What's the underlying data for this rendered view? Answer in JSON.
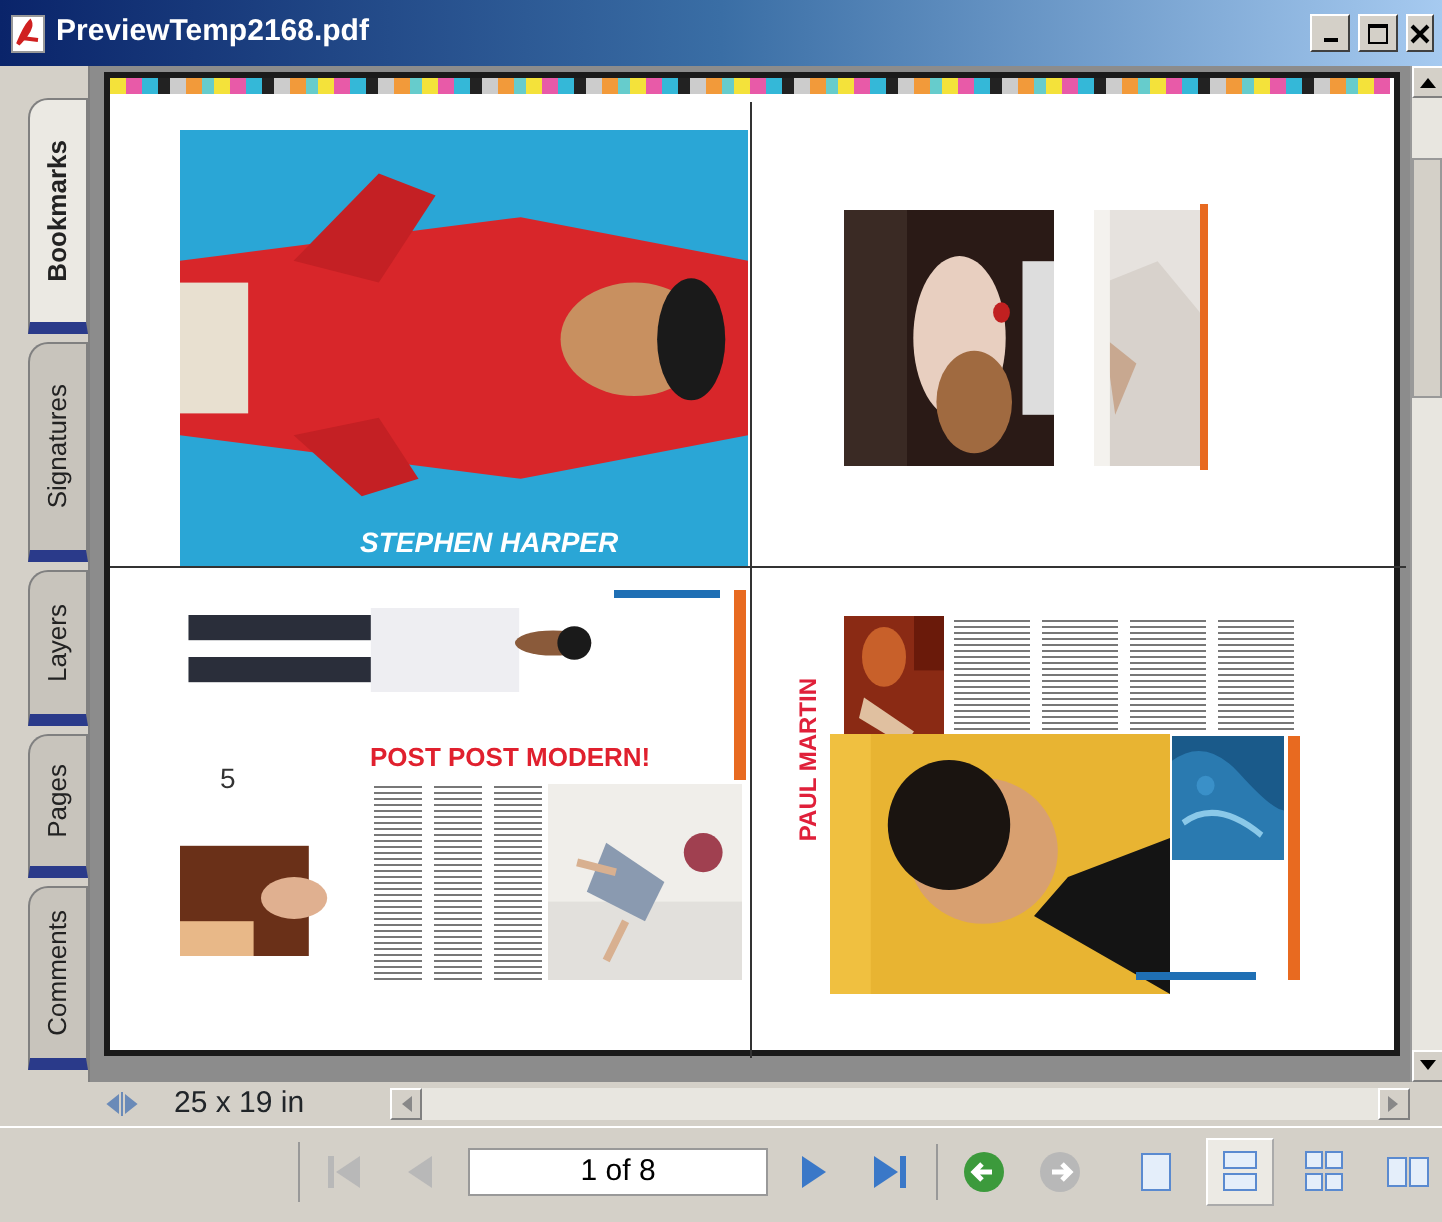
{
  "window": {
    "title": "PreviewTemp2168.pdf"
  },
  "side_tabs": [
    {
      "label": "Bookmarks",
      "selected": true
    },
    {
      "label": "Signatures",
      "selected": false
    },
    {
      "label": "Layers",
      "selected": false
    },
    {
      "label": "Pages",
      "selected": false
    },
    {
      "label": "Comments",
      "selected": false
    }
  ],
  "document": {
    "texts": [
      {
        "kind": "caption",
        "text": "STEPHEN HARPER"
      },
      {
        "kind": "headline",
        "text": "POST POST MODERN!"
      },
      {
        "kind": "page-number",
        "text": "5"
      },
      {
        "kind": "vertical",
        "text": "PAUL MARTIN"
      }
    ]
  },
  "status": {
    "page_size": "25 x 19 in"
  },
  "toolbar": {
    "nav_buttons": [
      {
        "kind": "first",
        "disabled": true
      },
      {
        "kind": "prev",
        "disabled": true
      },
      {
        "kind": "field",
        "text": "1 of 8"
      },
      {
        "kind": "next",
        "disabled": false
      },
      {
        "kind": "last",
        "disabled": false
      },
      {
        "kind": "back",
        "disabled": false
      },
      {
        "kind": "forward",
        "disabled": true
      }
    ],
    "view_buttons": [
      {
        "kind": "single",
        "selected": false
      },
      {
        "kind": "continuous",
        "selected": true
      },
      {
        "kind": "continuous-facing",
        "selected": false
      },
      {
        "kind": "facing",
        "selected": false
      }
    ]
  }
}
